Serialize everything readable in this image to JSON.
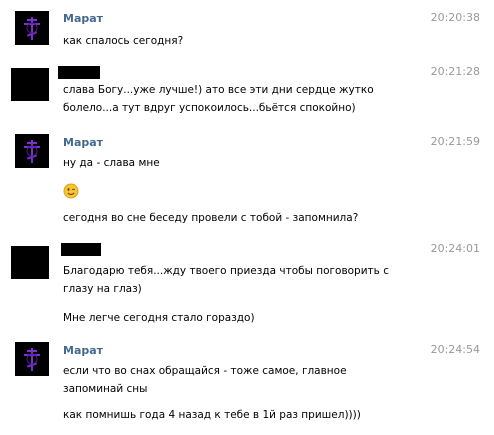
{
  "messages": [
    {
      "author": "Марат",
      "time": "20:20:38",
      "lines": [
        "как спалось сегодня?"
      ]
    },
    {
      "author": "",
      "time": "20:21:28",
      "lines": [
        "слава Богу...уже лучше!) ато все эти дни сердце жутко",
        "болело...а тут вдруг успокоилось...бьётся спокойно)"
      ]
    },
    {
      "author": "Марат",
      "time": "20:21:59",
      "lines": [
        "ну да - слава мне",
        "сегодня во сне беседу провели с тобой - запомнила?"
      ],
      "emoji": "wink-emoji"
    },
    {
      "author": "",
      "time": "20:24:01",
      "lines": [
        "Благодарю тебя...жду твоего приезда чтобы поговорить с",
        "глазу на глаз)",
        "Мне легче сегодня стало гораздо)"
      ]
    },
    {
      "author": "Марат",
      "time": "20:24:54",
      "lines": [
        "если что во снах обращайся - тоже самое, главное",
        "запоминай сны",
        "как помнишь года 4 назад к тебе в 1й раз пришел))))"
      ]
    }
  ],
  "colors": {
    "author_name": "#45688e",
    "time": "#999999",
    "text": "#000000",
    "avatar_glyph": "#7b2fd0"
  }
}
